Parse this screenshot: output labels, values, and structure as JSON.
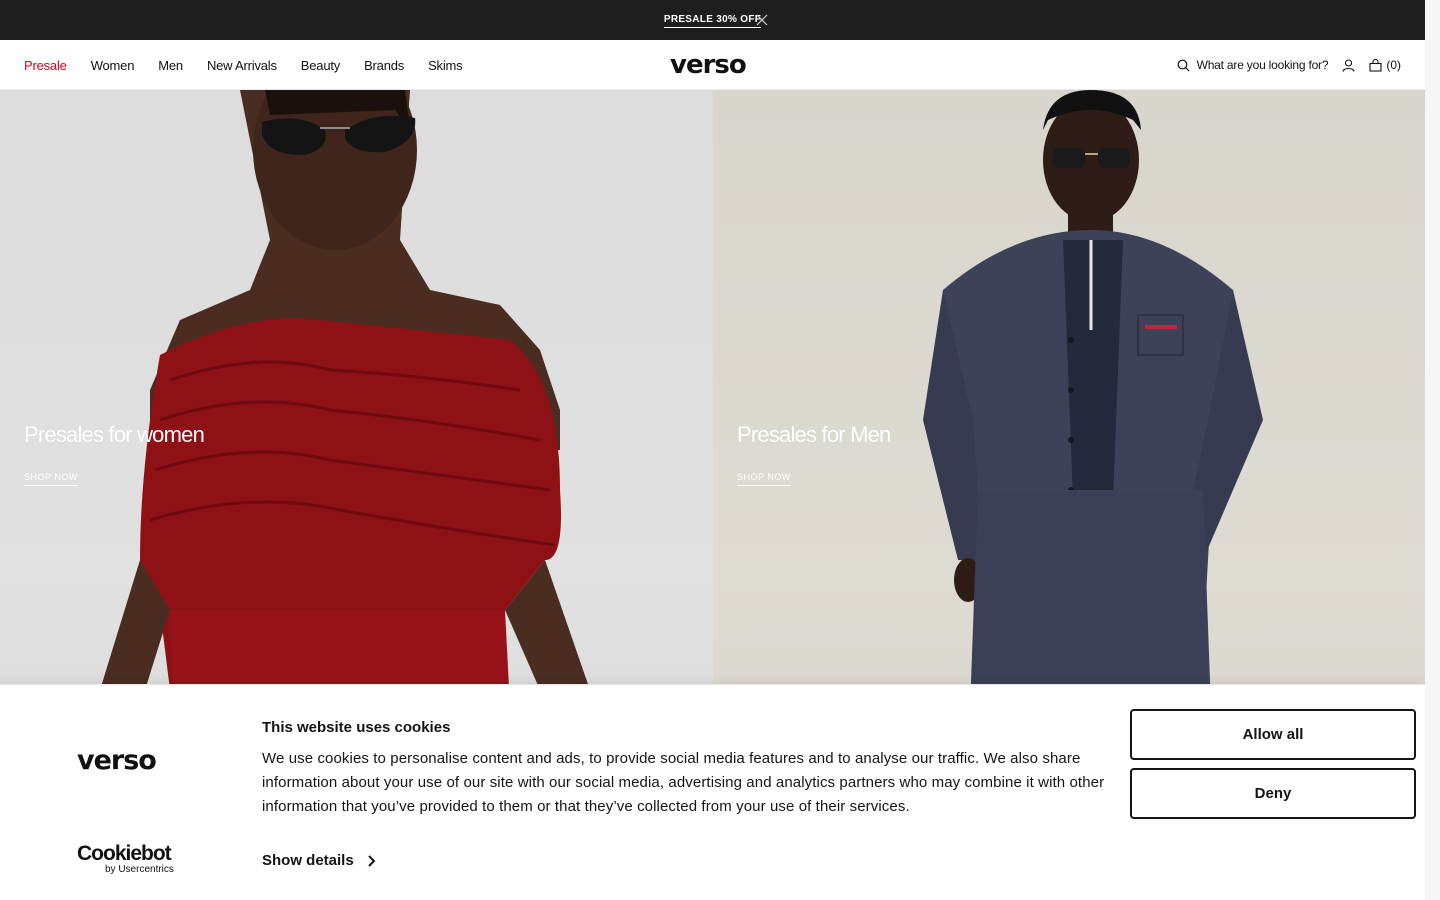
{
  "promo": {
    "text": "PRESALE 30% OFF",
    "close_icon": "close-icon"
  },
  "header": {
    "nav": [
      {
        "label": "Presale",
        "active": true
      },
      {
        "label": "Women"
      },
      {
        "label": "Men"
      },
      {
        "label": "New Arrivals"
      },
      {
        "label": "Beauty"
      },
      {
        "label": "Brands"
      },
      {
        "label": "Skims"
      }
    ],
    "logo": "verso",
    "search_placeholder": "What are you looking for?",
    "search_icon": "search-icon",
    "account_icon": "user-icon",
    "bag_icon": "bag-icon",
    "bag_count": "(0)"
  },
  "hero": {
    "left": {
      "heading": "Presales for women",
      "link": "SHOP NOW"
    },
    "right": {
      "heading": "Presales for Men",
      "link": "SHOP NOW"
    }
  },
  "cookie_banner": {
    "logo": "verso",
    "title": "This website uses cookies",
    "text": "We use cookies to personalise content and ads, to provide social media features and to analyse our traffic. We also share information about your use of our site with our social media, advertising and analytics partners who may combine it with other information that you’ve provided to them or that they’ve collected from your use of their services.",
    "show_details": "Show details",
    "allow_all": "Allow all",
    "deny": "Deny",
    "cookiebot_name": "Cookiebot",
    "cookiebot_by": "by Usercentrics"
  },
  "colors": {
    "accent": "#e1001a",
    "promo_bg": "#1e1e1e",
    "text": "#141414"
  }
}
